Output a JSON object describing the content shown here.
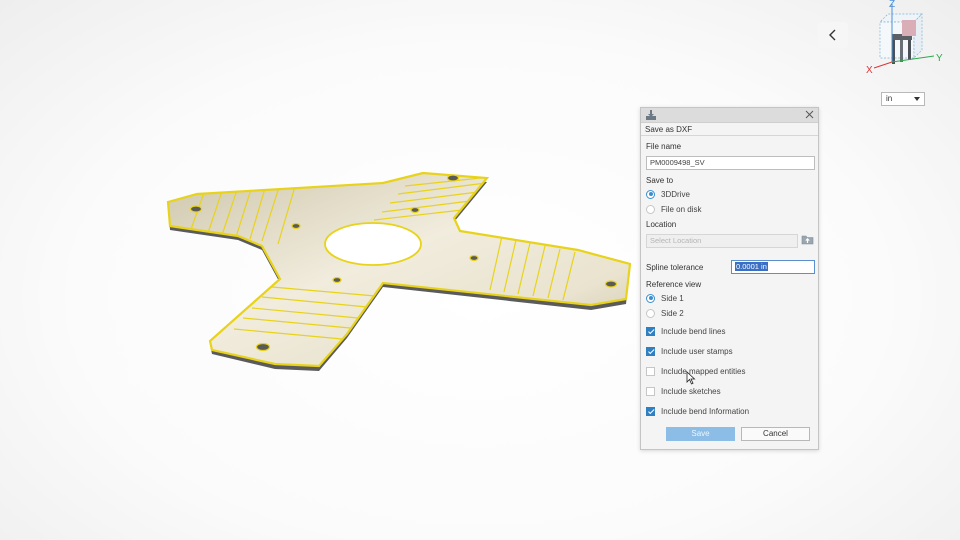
{
  "viewport": {
    "part_name": "sheet-metal-cross-bracket",
    "accent_color": "#e8d31a"
  },
  "toolbar": {
    "back_icon": "chevron-left-icon"
  },
  "view_cube": {
    "axis_z": "Z",
    "axis_y": "Y",
    "axis_x": "X"
  },
  "units": {
    "selected": "in"
  },
  "dialog": {
    "title": "Save as DXF",
    "file_name_label": "File name",
    "file_name_value": "PM0009498_SV",
    "save_to_label": "Save to",
    "save_to_options": [
      {
        "label": "3DDrive",
        "selected": true
      },
      {
        "label": "File on disk",
        "selected": false
      }
    ],
    "location_label": "Location",
    "location_placeholder": "Select Location",
    "spline_label": "Spline tolerance",
    "spline_value": "0.0001 in",
    "reference_label": "Reference view",
    "reference_options": [
      {
        "label": "Side 1",
        "selected": true
      },
      {
        "label": "Side 2",
        "selected": false
      }
    ],
    "checkboxes": [
      {
        "label": "Include bend lines",
        "checked": true
      },
      {
        "label": "Include user stamps",
        "checked": true
      },
      {
        "label": "Include mapped entities",
        "checked": false
      },
      {
        "label": "Include sketches",
        "checked": false
      },
      {
        "label": "Include bend Information",
        "checked": true
      }
    ],
    "save_label": "Save",
    "cancel_label": "Cancel",
    "colors": {
      "primary": "#2f7fc1",
      "save_disabled": "#8bbde6"
    }
  }
}
